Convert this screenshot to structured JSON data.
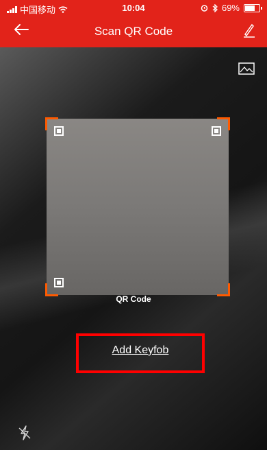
{
  "status_bar": {
    "carrier": "中国移动",
    "time": "10:04",
    "battery_percent": "69%",
    "wifi_icon": "wifi-icon",
    "alarm_icon": "alarm-icon",
    "bluetooth_icon": "bluetooth-icon"
  },
  "header": {
    "title": "Scan QR Code",
    "back_icon": "arrow-left-icon",
    "edit_icon": "pencil-icon"
  },
  "scanner": {
    "gallery_icon": "image-icon",
    "frame_label": "QR Code",
    "accent_color": "#ff5a00"
  },
  "actions": {
    "add_keyfob": "Add Keyfob",
    "flash_icon": "flash-off-icon"
  },
  "colors": {
    "header_bg": "#e2231a",
    "highlight_box": "#ff0000"
  }
}
